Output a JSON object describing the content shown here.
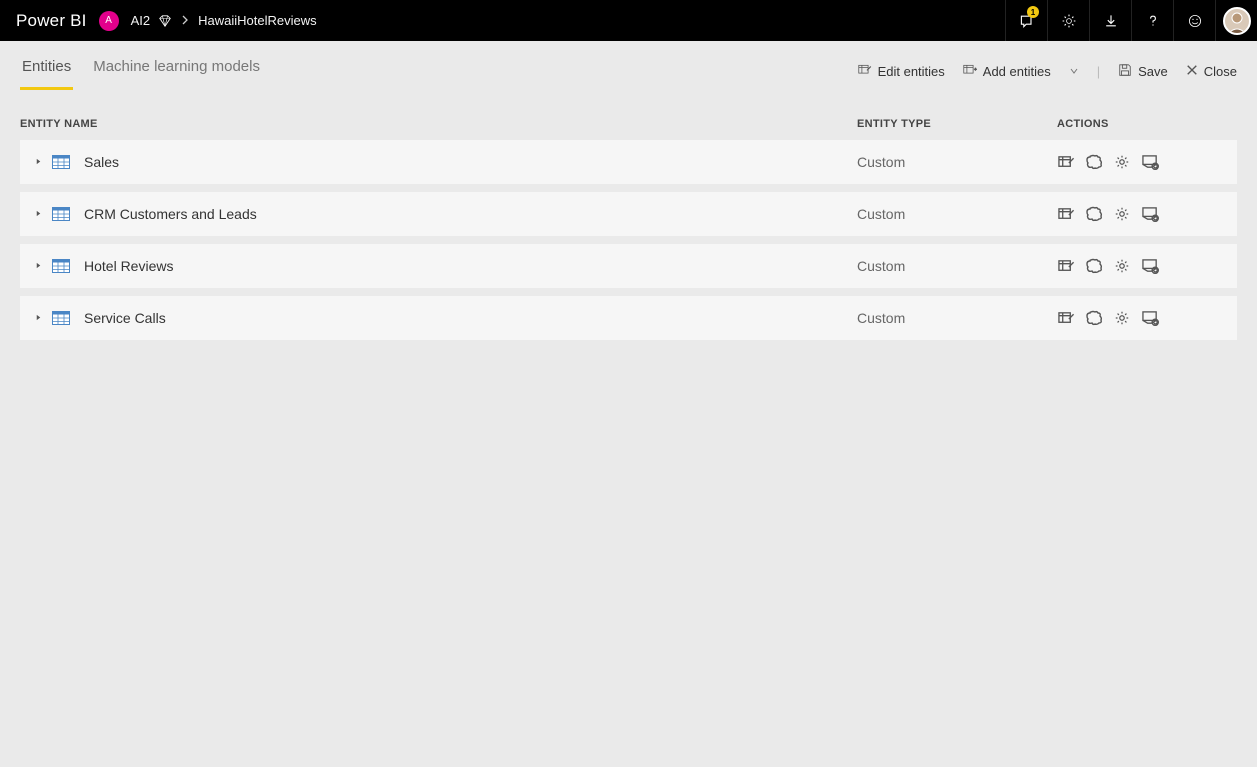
{
  "header": {
    "product": "Power BI",
    "workspace_initial": "A",
    "workspace_name": "AI2",
    "page_name": "HawaiiHotelReviews",
    "notification_count": "1"
  },
  "tabs": {
    "entities": "Entities",
    "ml_models": "Machine learning models"
  },
  "toolbar": {
    "edit_entities": "Edit entities",
    "add_entities": "Add entities",
    "save": "Save",
    "close": "Close"
  },
  "columns": {
    "name": "ENTITY NAME",
    "type": "ENTITY TYPE",
    "actions": "ACTIONS"
  },
  "entities": [
    {
      "name": "Sales",
      "type": "Custom"
    },
    {
      "name": "CRM Customers and Leads",
      "type": "Custom"
    },
    {
      "name": "Hotel Reviews",
      "type": "Custom"
    },
    {
      "name": "Service Calls",
      "type": "Custom"
    }
  ]
}
